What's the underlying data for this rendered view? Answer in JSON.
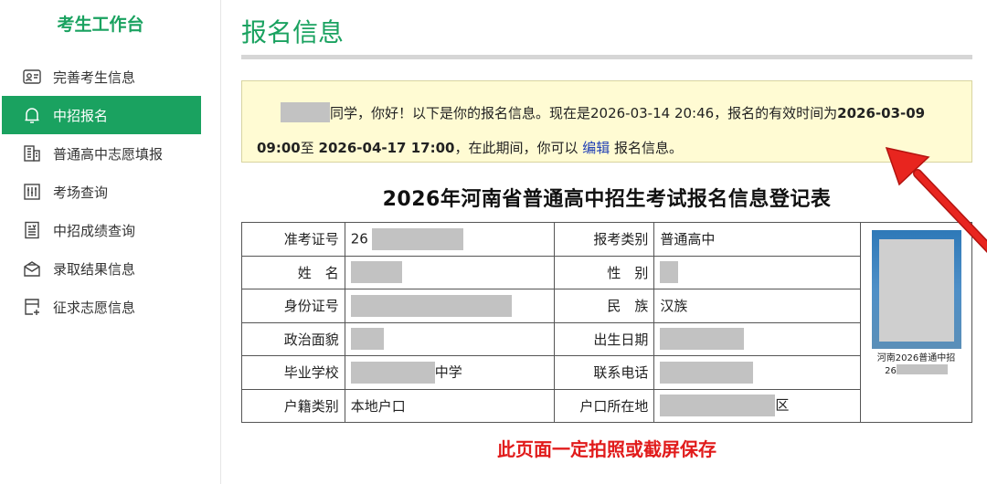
{
  "sidebar": {
    "title": "考生工作台",
    "items": [
      {
        "label": "完善考生信息",
        "icon": "id-card-icon"
      },
      {
        "label": "中招报名",
        "icon": "bell-icon"
      },
      {
        "label": "普通高中志愿填报",
        "icon": "building-icon"
      },
      {
        "label": "考场查询",
        "icon": "grid-list-icon"
      },
      {
        "label": "中招成绩查询",
        "icon": "document-icon"
      },
      {
        "label": "录取结果信息",
        "icon": "mail-icon"
      },
      {
        "label": "征求志愿信息",
        "icon": "form-plus-icon"
      }
    ]
  },
  "main": {
    "page_title": "报名信息",
    "notice": {
      "greeting_suffix": "同学，你好！以下是你的报名信息。现在是2026-03-14 20:46，报名的有效时间为",
      "start_time": "2026-03-09 09:00",
      "to": "至 ",
      "end_time": "2026-04-17 17:00",
      "during_text": "，在此期间，你可以",
      "edit_link": "编辑",
      "after_link": "报名信息。"
    },
    "form_title": "2026年河南省普通高中招生考试报名信息登记表",
    "rows": [
      {
        "label1": "准考证号",
        "value1_prefix": "26",
        "label2": "报考类别",
        "value2": "普通高中"
      },
      {
        "label1": "姓　名",
        "label2": "性　别"
      },
      {
        "label1": "身份证号",
        "label2": "民　族",
        "value2": "汉族"
      },
      {
        "label1": "政治面貌",
        "label2": "出生日期"
      },
      {
        "label1": "毕业学校",
        "value1_suffix": "中学",
        "label2": "联系电话"
      },
      {
        "label1": "户籍类别",
        "value1": "本地户口",
        "label2": "户口所在地",
        "value2_suffix": "区"
      }
    ],
    "photo_caption": "河南2026普通中招",
    "photo_caption_prefix": "26",
    "save_note": "此页面一定拍照或截屏保存"
  },
  "colors": {
    "brand_green": "#1aa260",
    "notice_bg": "#fffbd3",
    "link_blue": "#1f3fb5",
    "warning_red": "#e11b1b",
    "arrow_red": "#e8251f"
  }
}
